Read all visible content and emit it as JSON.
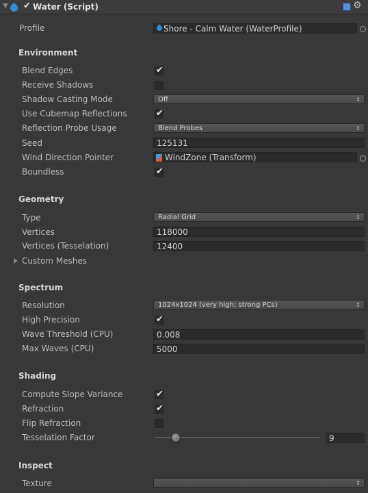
{
  "header": {
    "title": "Water (Script)",
    "enabled": true
  },
  "profile": {
    "label": "Profile",
    "value": "Shore - Calm Water (WaterProfile)"
  },
  "environment": {
    "title": "Environment",
    "blend_edges": {
      "label": "Blend Edges",
      "checked": true
    },
    "receive_shadows": {
      "label": "Receive Shadows",
      "checked": false
    },
    "shadow_casting": {
      "label": "Shadow Casting Mode",
      "value": "Off"
    },
    "cubemap_reflections": {
      "label": "Use Cubemap Reflections",
      "checked": true
    },
    "reflection_probe": {
      "label": "Reflection Probe Usage",
      "value": "Blend Probes"
    },
    "seed": {
      "label": "Seed",
      "value": "125131"
    },
    "wind": {
      "label": "Wind Direction Pointer",
      "value": "WindZone (Transform)"
    },
    "boundless": {
      "label": "Boundless",
      "checked": true
    }
  },
  "geometry": {
    "title": "Geometry",
    "type": {
      "label": "Type",
      "value": "Radial Grid"
    },
    "vertices": {
      "label": "Vertices",
      "value": "118000"
    },
    "vertices_tess": {
      "label": "Vertices (Tesselation)",
      "value": "12400"
    },
    "custom_meshes": {
      "label": "Custom Meshes"
    }
  },
  "spectrum": {
    "title": "Spectrum",
    "resolution": {
      "label": "Resolution",
      "value": "1024x1024 (very high; strong PCs)"
    },
    "high_precision": {
      "label": "High Precision",
      "checked": true
    },
    "wave_threshold": {
      "label": "Wave Threshold (CPU)",
      "value": "0.008"
    },
    "max_waves": {
      "label": "Max Waves (CPU)",
      "value": "5000"
    }
  },
  "shading": {
    "title": "Shading",
    "slope_variance": {
      "label": "Compute Slope Variance",
      "checked": true
    },
    "refraction": {
      "label": "Refraction",
      "checked": true
    },
    "flip_refraction": {
      "label": "Flip Refraction",
      "checked": false
    },
    "tess_factor": {
      "label": "Tesselation Factor",
      "value": "9"
    }
  },
  "inspect": {
    "title": "Inspect",
    "texture": {
      "label": "Texture",
      "value": ""
    }
  },
  "icons": {
    "dropdown_arrows": "↕",
    "check": "✔",
    "gear": "⚙"
  }
}
